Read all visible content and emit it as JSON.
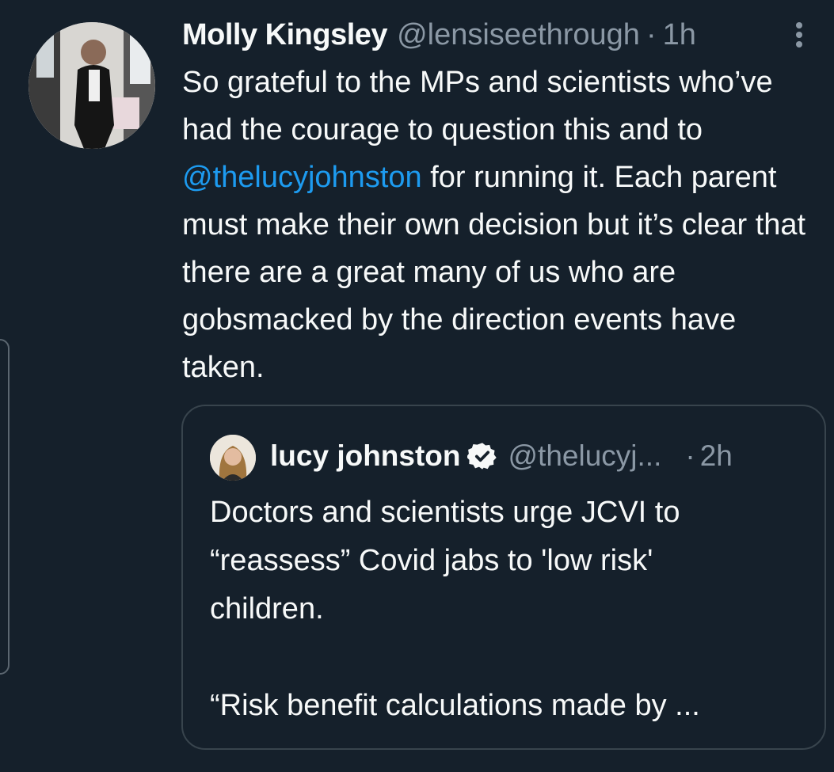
{
  "tweet": {
    "author_name": "Molly Kingsley",
    "author_handle": "@lensiseethrough",
    "separator": "·",
    "time": "1h",
    "text_before_mention": "So grateful to the MPs and scientists who’ve had the courage to question this and to ",
    "mention": "@thelucyjohnston",
    "text_after_mention": " for running it. Each parent must make their own decision but it’s clear that there are a great many of us who are gobsmacked by the direction events have taken."
  },
  "quoted_tweet": {
    "author_name": "lucy johnston",
    "author_handle": "@thelucyj...",
    "separator": "·",
    "time": "2h",
    "lines": [
      "Doctors and scientists urge JCVI to",
      "“reassess” Covid jabs to 'low risk'",
      "children."
    ],
    "excerpt": "“Risk benefit calculations made by ..."
  },
  "icons": {
    "more": "more-vertical-icon",
    "verified": "verified-badge-icon"
  },
  "colors": {
    "background": "#15202b",
    "mention": "#1d9bf0",
    "secondary_text": "#8b98a5",
    "border": "#38444d"
  }
}
